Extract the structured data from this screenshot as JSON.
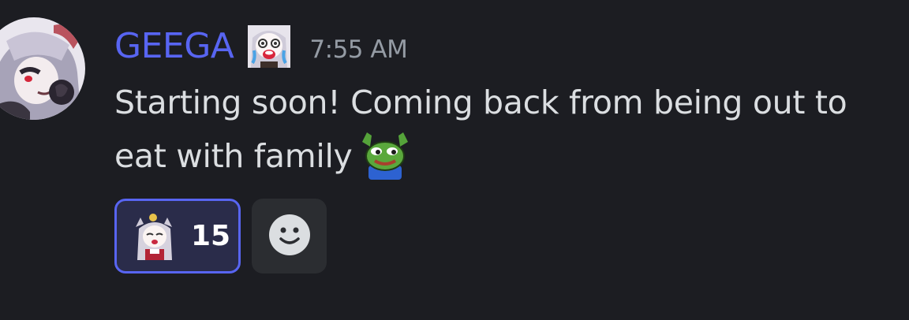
{
  "message": {
    "author": "GEEGA",
    "timestamp": "7:55 AM",
    "text": "Starting soon! Coming back from being out to eat with family",
    "inline_emoji": "pepe-arms-up-emoji",
    "role_icon": "anime-girl-crying-emoji"
  },
  "reactions": [
    {
      "emoji": "anime-girl-cheering-emoji",
      "count": "15",
      "reacted": true
    }
  ],
  "add_reaction_icon": "smiley-face-icon",
  "colors": {
    "background": "#1c1d22",
    "username": "#5865f2",
    "timestamp": "#949ba4",
    "text": "#dbdee1",
    "reaction_border": "#5865f2",
    "reaction_bg": "#2a2c4a",
    "add_reaction_bg": "#2b2d31"
  }
}
